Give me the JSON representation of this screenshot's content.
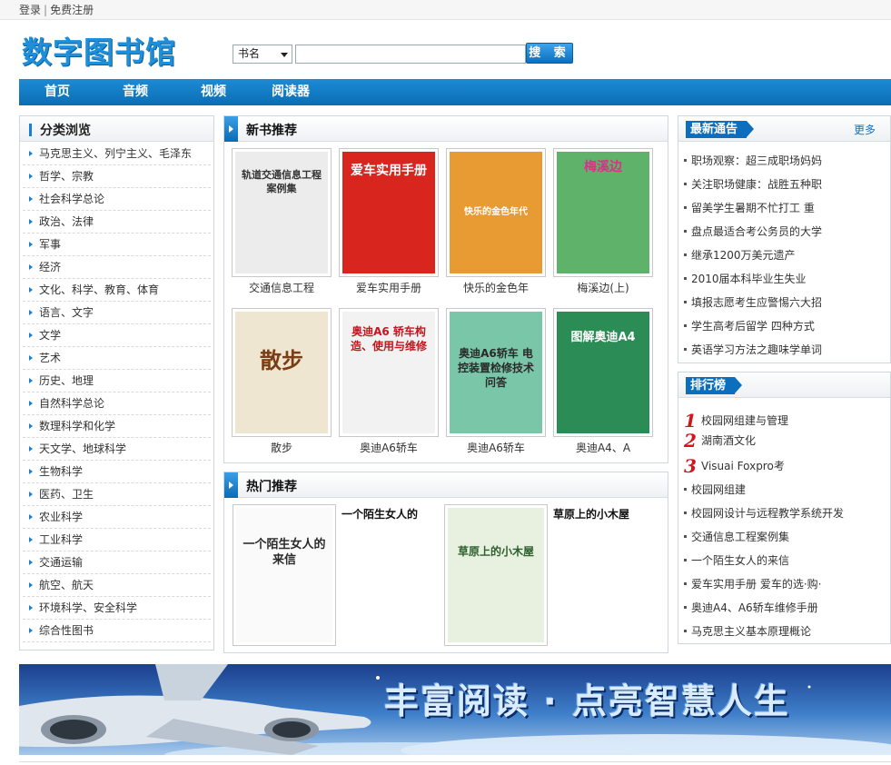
{
  "topbar": {
    "login": "登录",
    "separator": "|",
    "register": "免费注册"
  },
  "logo": {
    "text": "数字图书馆"
  },
  "search": {
    "type_selected": "书名",
    "input_value": "",
    "button": "搜 索"
  },
  "nav": [
    "首页",
    "音频",
    "视频",
    "阅读器"
  ],
  "categories": {
    "title": "分类浏览",
    "items": [
      "马克思主义、列宁主义、毛泽东",
      "哲学、宗教",
      "社会科学总论",
      "政治、法律",
      "军事",
      "经济",
      "文化、科学、教育、体育",
      "语言、文字",
      "文学",
      "艺术",
      "历史、地理",
      "自然科学总论",
      "数理科学和化学",
      "天文学、地球科学",
      "生物科学",
      "医药、卫生",
      "农业科学",
      "工业科学",
      "交通运输",
      "航空、航天",
      "环境科学、安全科学",
      "综合性图书"
    ]
  },
  "new_books": {
    "title": "新书推荐",
    "items": [
      {
        "name": "交通信息工程",
        "cover_title": "轨道交通信息工程案例集",
        "cover_color": "#ececec"
      },
      {
        "name": "爱车实用手册",
        "cover_title": "爱车实用手册",
        "cover_color": "#d8261e"
      },
      {
        "name": "快乐的金色年",
        "cover_title": "快乐的金色年代",
        "cover_color": "#e89a33"
      },
      {
        "name": "梅溪边(上)",
        "cover_title": "梅溪边",
        "cover_color": "#5fb26a"
      },
      {
        "name": "散步",
        "cover_title": "散步",
        "cover_color": "#efe6d2"
      },
      {
        "name": "奥迪A6轿车",
        "cover_title": "奥迪A6 轿车构造、使用与维修",
        "cover_color": "#f2f2f2"
      },
      {
        "name": "奥迪A6轿车",
        "cover_title": "奥迪A6轿车 电控装置检修技术问答",
        "cover_color": "#79c6a8"
      },
      {
        "name": "奥迪A4、A",
        "cover_title": "图解奥迪A4",
        "cover_color": "#2c8c55"
      }
    ]
  },
  "hot_books": {
    "title": "热门推荐",
    "items": [
      {
        "name": "一个陌生女人的",
        "cover_title": "一个陌生女人的来信",
        "cover_color": "#fafafa"
      },
      {
        "name": "草原上的小木屋",
        "cover_title": "草原上的小木屋",
        "cover_color": "#e8f0e0"
      }
    ]
  },
  "news": {
    "title": "最新通告",
    "more": "更多",
    "items": [
      "职场观察：超三成职场妈妈",
      "关注职场健康：战胜五种职",
      "留美学生暑期不忙打工 重",
      "盘点最适合考公务员的大学",
      "继承1200万美元遗产",
      "2010届本科毕业生失业",
      "填报志愿考生应警惕六大招",
      "学生高考后留学 四种方式",
      "英语学习方法之趣味学单词"
    ]
  },
  "ranking": {
    "title": "排行榜",
    "top": [
      {
        "rank": "1",
        "name": "校园网组建与管理"
      },
      {
        "rank": "2",
        "name": "湖南酒文化"
      },
      {
        "rank": "3",
        "name": "Visuai Foxpro考"
      }
    ],
    "items": [
      "校园网组建",
      "校园网设计与远程教学系统开发",
      "交通信息工程案例集",
      "一个陌生女人的来信",
      "爱车实用手册 爱车的选·购·",
      "奥迪A4、A6轿车维修手册",
      "马克思主义基本原理概论"
    ]
  },
  "banner": {
    "text": "丰富阅读 · 点亮智慧人生"
  }
}
